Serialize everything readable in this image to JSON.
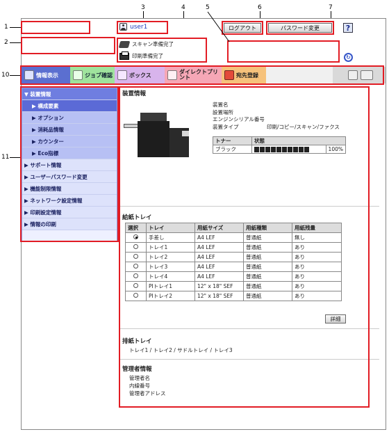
{
  "header": {
    "user": "user1",
    "logout_label": "ログアウト",
    "password_change_label": "パスワード変更",
    "help_label": "?"
  },
  "status": {
    "scan": "スキャン準備完了",
    "print": "印刷準備完了"
  },
  "tabs": [
    {
      "label": "情報表示",
      "icon": "info-icon"
    },
    {
      "label": "ジョブ確認",
      "icon": "job-icon"
    },
    {
      "label": "ボックス",
      "icon": "box-icon"
    },
    {
      "label": "ダイレクトプリント",
      "icon": "direct-print-icon"
    },
    {
      "label": "宛先登録",
      "icon": "address-icon"
    }
  ],
  "sidebar": {
    "items": [
      {
        "label": "▼ 装置情報"
      },
      {
        "label": "▶ 構成要素"
      },
      {
        "label": "▶ オプション"
      },
      {
        "label": "▶ 消耗品情報"
      },
      {
        "label": "▶ カウンター"
      },
      {
        "label": "▶ Eco指標"
      },
      {
        "label": "▶ サポート情報"
      },
      {
        "label": "▶ ユーザーパスワード変更"
      },
      {
        "label": "▶ 機能制限情報"
      },
      {
        "label": "▶ ネットワーク設定情報"
      },
      {
        "label": "▶ 印刷設定情報"
      },
      {
        "label": "▶ 情報の印刷"
      }
    ]
  },
  "device": {
    "title": "装置情報",
    "name_label": "装置名",
    "location_label": "設置場所",
    "serial_label": "エンジンシリアル番号",
    "type_label": "装置タイプ",
    "type_value": "印刷/コピー/スキャン/ファクス",
    "toner_header": "トナー",
    "state_header": "状態",
    "toner_name": "ブラック",
    "toner_level": "100%",
    "toner_fraction": 1.0
  },
  "paper_tray": {
    "title": "給紙トレイ",
    "headers": [
      "選択",
      "トレイ",
      "用紙サイズ",
      "用紙種類",
      "用紙残量"
    ],
    "rows": [
      {
        "tray": "手差し",
        "size": "A4 LEF",
        "type": "普通紙",
        "remaining": "無し"
      },
      {
        "tray": "トレイ1",
        "size": "A4 LEF",
        "type": "普通紙",
        "remaining": "あり"
      },
      {
        "tray": "トレイ2",
        "size": "A4 LEF",
        "type": "普通紙",
        "remaining": "あり"
      },
      {
        "tray": "トレイ3",
        "size": "A4 LEF",
        "type": "普通紙",
        "remaining": "あり"
      },
      {
        "tray": "トレイ4",
        "size": "A4 LEF",
        "type": "普通紙",
        "remaining": "あり"
      },
      {
        "tray": "PIトレイ1",
        "size": "12\" x 18\" SEF",
        "type": "普通紙",
        "remaining": "あり"
      },
      {
        "tray": "PIトレイ2",
        "size": "12\" x 18\" SEF",
        "type": "普通紙",
        "remaining": "あり"
      }
    ],
    "detail_label": "詳細"
  },
  "output_tray": {
    "title": "排紙トレイ",
    "value": "トレイ1 / トレイ2 / サドルトレイ / トレイ3"
  },
  "admin": {
    "title": "管理者情報",
    "name_label": "管理者名",
    "ext_label": "内線番号",
    "address_label": "管理者アドレス"
  },
  "callouts": [
    "1",
    "2",
    "3",
    "4",
    "5",
    "6",
    "7",
    "8",
    "9",
    "10",
    "11",
    "12"
  ]
}
